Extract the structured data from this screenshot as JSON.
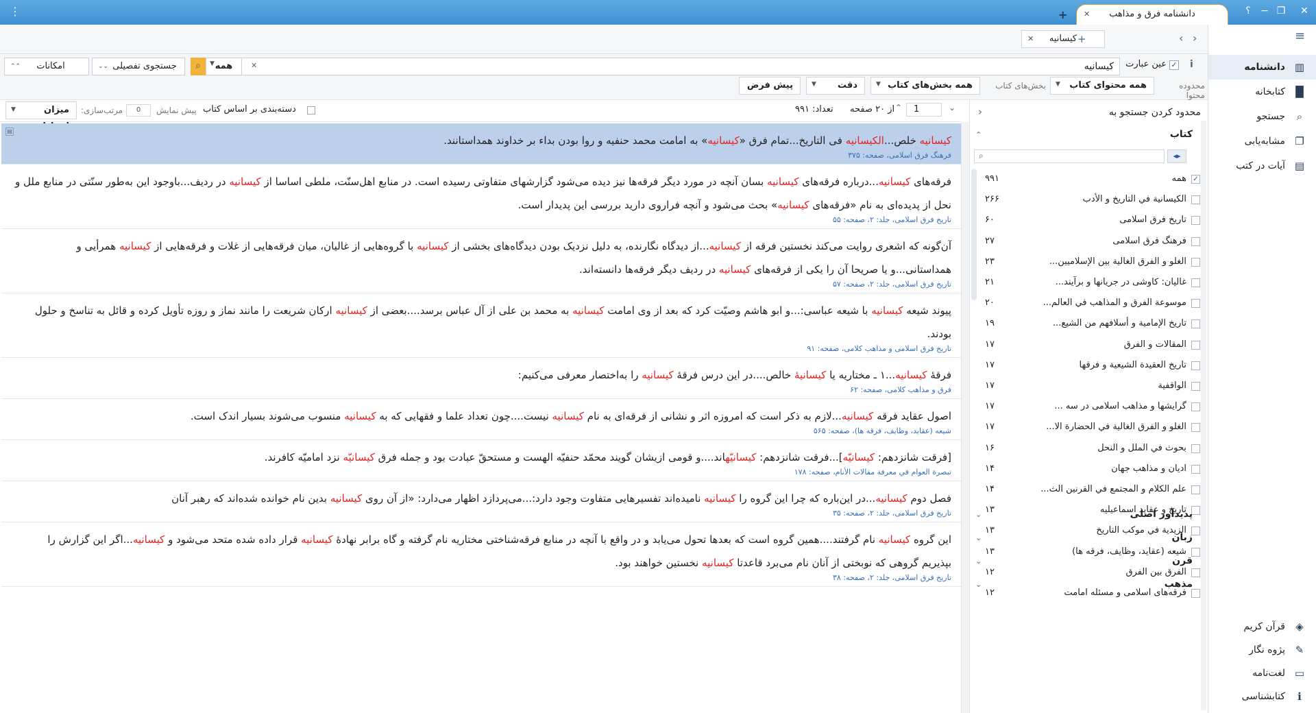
{
  "window": {
    "title": "دانشنامه فرق و مذاهب",
    "help": "؟"
  },
  "doc_tab": {
    "label": "کیسانیه"
  },
  "search": {
    "exact_label": "عین عبارت",
    "query": "کیسانیه",
    "scope_value": "همه",
    "advanced_label": "جستجوی تفصیلی",
    "options_label": "امکانات",
    "info": "i"
  },
  "filters": {
    "range_label": "محدوده محتوا",
    "range_value": "همه محتوای کتاب",
    "parts_label": "بخش‌های کتاب",
    "parts_value": "همه بخش‌های کتاب",
    "precision_value": "دقت",
    "default_value": "پیش فرض"
  },
  "results_bar": {
    "group_label": "دسته‌بندی بر اساس کتاب",
    "preview_label": "پیش نمایش",
    "preview_value": "0",
    "sort_label": "مرتب‌سازی:",
    "sort_value": "میزان ارتباط",
    "page_value": "1",
    "page_total": "از ۲۰ صفحه",
    "count": "تعداد: ۹۹۱"
  },
  "results": [
    {
      "segs": [
        [
          "کیسانیه",
          "k"
        ],
        [
          " خلص...",
          ""
        ],
        [
          "الکیسانیه",
          "k"
        ],
        [
          " فی التاریخ...تمام فرق «",
          ""
        ],
        [
          "کیسانیه",
          "k"
        ],
        [
          "» به امامت محمد حنفیه و روا بودن بداء بر خداوند همداستانند.",
          ""
        ]
      ],
      "source": "فرهنگ فرق اسلامی، صفحه: ۳۷۵"
    },
    {
      "segs": [
        [
          "فرقه‌های ",
          ""
        ],
        [
          "کیسانیه",
          "k"
        ],
        [
          "...درباره فرقه‌های ",
          ""
        ],
        [
          "کیسانیه",
          "k"
        ],
        [
          " بسان آنچه در مورد دیگر فرقه‌ها نیز دیده می‌شود گزارشهای متفاوتی رسیده است. در منابع اهل‌سنّت، ملطی اساسا از ",
          ""
        ],
        [
          "کیسانیه",
          "k"
        ],
        [
          " در ردیف...باوجود این به‌طور سنّتی در منابع ملل و نحل از پدیده‌ای به نام «فرقه‌های ",
          ""
        ],
        [
          "کیسانیه",
          "k"
        ],
        [
          "» بحث می‌شود و آنچه فراروی دارید بررسی این پدیدار است.",
          ""
        ]
      ],
      "source": "تاریخ فرق اسلامی، جلد: ۲، صفحه: ۵۵"
    },
    {
      "segs": [
        [
          "آن‌گونه که اشعری روایت می‌کند نخستین فرقه از ",
          ""
        ],
        [
          "کیسانیه",
          "k"
        ],
        [
          "...از دیدگاه نگارنده، به دلیل نزدیک بودن دیدگاه‌های بخشی از ",
          ""
        ],
        [
          "کیسانیه",
          "k"
        ],
        [
          " با گروه‌هایی از غالیان، میان فرقه‌هایی از غلات و فرقه‌هایی از ",
          ""
        ],
        [
          "کیسانیه",
          "k"
        ],
        [
          " همرأیی و همداستانی...و یا صریحا آن را یکی از فرقه‌های ",
          ""
        ],
        [
          "کیسانیه",
          "k"
        ],
        [
          " در ردیف دیگر فرقه‌ها دانسته‌اند.",
          ""
        ]
      ],
      "source": "تاریخ فرق اسلامی، جلد: ۲، صفحه: ۵۷"
    },
    {
      "segs": [
        [
          "پیوند شیعه ",
          ""
        ],
        [
          "کیسانیه",
          "k"
        ],
        [
          " با شیعه عباسی:...و ابو هاشم وصیّت کرد که بعد از وی امامت ",
          ""
        ],
        [
          "کیسانیه",
          "k"
        ],
        [
          " به محمد بن علی از آل عباس برسد....بعضی از ",
          ""
        ],
        [
          "کیسانیه",
          "k"
        ],
        [
          " ارکان شریعت را مانند نماز و روزه تأویل کرده و قائل به تناسخ و حلول بودند.",
          ""
        ]
      ],
      "source": "تاریخ فرق اسلامی و مذاهب کلامی، صفحه: ۹۱"
    },
    {
      "segs": [
        [
          "فرقۀ ",
          ""
        ],
        [
          "کیسانیه",
          "k"
        ],
        [
          "...۱ ـ مختاریه یا ",
          ""
        ],
        [
          "کیسانیۀ",
          "k"
        ],
        [
          " خالص....در این درس فرقۀ ",
          ""
        ],
        [
          "کیسانیه",
          "k"
        ],
        [
          " را به‌اختصار معرفی می‌کنیم:",
          ""
        ]
      ],
      "source": "فرق و مذاهب کلامی، صفحه: ۶۲"
    },
    {
      "segs": [
        [
          "اصول عقاید فرقه ",
          ""
        ],
        [
          "کیسانیه",
          "k"
        ],
        [
          "...لازم به ذکر است که امروزه اثر و نشانی از فرقه‌ای به نام ",
          ""
        ],
        [
          "کیسانیه",
          "k"
        ],
        [
          " نیست....چون تعداد علما و فقهایی که به ",
          ""
        ],
        [
          "کیسانیه",
          "k"
        ],
        [
          " منسوب می‌شوند بسیار اندک است.",
          ""
        ]
      ],
      "source": "شیعه (عقاید، وظایف، فرقه ها)، صفحه: ۵۶۵"
    },
    {
      "segs": [
        [
          "[فرقت شانزدهم: ",
          ""
        ],
        [
          "کیسانیّه",
          "k"
        ],
        [
          "]...فرقت شانزدهم: ",
          ""
        ],
        [
          "کیسانیّه",
          "k"
        ],
        [
          "اند....و قومی ازیشان گویند محمّد حنفیّه الهست و مستحقّ عبادت بود و جمله فرق ",
          ""
        ],
        [
          "کیسانیّه",
          "k"
        ],
        [
          " نزد امامیّه کافرند.",
          ""
        ]
      ],
      "source": "تبصرة العوام في معرفة مقالات الأنام، صفحه: ۱۷۸"
    },
    {
      "segs": [
        [
          "فصل دوم ",
          ""
        ],
        [
          "کیسانیه",
          "k"
        ],
        [
          "...در این‌باره که چرا این گروه را ",
          ""
        ],
        [
          "کیسانیه",
          "k"
        ],
        [
          " نامیده‌اند تفسیرهایی متفاوت وجود دارد:...می‌پردازد اظهار می‌دارد: «از آن روی ",
          ""
        ],
        [
          "کیسانیه",
          "k"
        ],
        [
          " بدین نام خوانده شده‌اند که رهبر آنان",
          ""
        ]
      ],
      "source": "تاریخ فرق اسلامی، جلد: ۲، صفحه: ۳۵"
    },
    {
      "segs": [
        [
          "این گروه ",
          ""
        ],
        [
          "کیسانیه",
          "k"
        ],
        [
          " نام گرفتند....همین گروه است که بعدها تحول می‌یابد و در واقع با آنچه در منابع فرقه‌شناختی مختاریه نام گرفته و گاه برابر نهادۀ ",
          ""
        ],
        [
          "کیسانیه",
          "k"
        ],
        [
          " قرار داده شده متحد می‌شود و ",
          ""
        ],
        [
          "کیسانیه",
          "k"
        ],
        [
          "...اگر این گزارش را بپذیریم گروهی که نوبختی از آنان نام می‌برد قاعدتا ",
          ""
        ],
        [
          "کیسانیه",
          "k"
        ],
        [
          " نخستین خواهند بود.",
          ""
        ]
      ],
      "source": "تاریخ فرق اسلامی، جلد: ۲، صفحه: ۳۸"
    }
  ],
  "panel": {
    "title": "محدود کردن جستجو به",
    "books_heading": "کتاب",
    "books": [
      {
        "name": "همه",
        "count": "۹۹۱",
        "checked": "✓"
      },
      {
        "name": "الكيسانية في التاريخ و الأدب",
        "count": "۲۶۶",
        "checked": ""
      },
      {
        "name": "تاریخ فرق اسلامی",
        "count": "۶۰",
        "checked": ""
      },
      {
        "name": "فرهنگ فرق اسلامی",
        "count": "۲۷",
        "checked": ""
      },
      {
        "name": "الغلو و الفرق الغالية بين الإسلاميين...",
        "count": "۲۳",
        "checked": ""
      },
      {
        "name": "غالیان: کاوشی در جریانها و برآیند...",
        "count": "۲۱",
        "checked": ""
      },
      {
        "name": "موسوعة الفرق و المذاهب في العالم...",
        "count": "۲۰",
        "checked": ""
      },
      {
        "name": "تاريخ الإمامية و أسلافهم من الشيع...",
        "count": "۱۹",
        "checked": ""
      },
      {
        "name": "المقالات و الفرق",
        "count": "۱۷",
        "checked": ""
      },
      {
        "name": "تاريخ العقيدة الشيعية و فرقها",
        "count": "۱۷",
        "checked": ""
      },
      {
        "name": "الواقفية",
        "count": "۱۷",
        "checked": ""
      },
      {
        "name": "گرایشها و مذاهب اسلامی در سه ...",
        "count": "۱۷",
        "checked": ""
      },
      {
        "name": "الغلو و الفرق الغالية في الحضارة الا...",
        "count": "۱۷",
        "checked": ""
      },
      {
        "name": "بحوث في الملل و النحل",
        "count": "۱۶",
        "checked": ""
      },
      {
        "name": "ادیان و مذاهب جهان",
        "count": "۱۴",
        "checked": ""
      },
      {
        "name": "علم الكلام و المجتمع في القرنين الث...",
        "count": "۱۴",
        "checked": ""
      },
      {
        "name": "تاریخ و عقاید اسماعیلیه",
        "count": "۱۳",
        "checked": ""
      },
      {
        "name": "الزيدية في موكب التاريخ",
        "count": "۱۳",
        "checked": ""
      },
      {
        "name": "شیعه (عقاید، وظایف، فرقه ها)",
        "count": "۱۳",
        "checked": ""
      },
      {
        "name": "الفرق بين الفرق",
        "count": "۱۲",
        "checked": ""
      },
      {
        "name": "فرقه‌های اسلامی و مسئله امامت",
        "count": "۱۲",
        "checked": ""
      }
    ],
    "sections": [
      "پدیدآور اصلی",
      "زبان",
      "قرن",
      "مذهب"
    ]
  },
  "nav": {
    "top": [
      {
        "label": "دانشنامه",
        "icon": "encyclopedia-icon",
        "glyph": "▥"
      },
      {
        "label": "کتابخانه",
        "icon": "library-icon",
        "glyph": "▐▌"
      },
      {
        "label": "جستجو",
        "icon": "search-icon",
        "glyph": "⌕"
      },
      {
        "label": "مشابه‌یابی",
        "icon": "similar-icon",
        "glyph": "❐"
      },
      {
        "label": "آیات در کتب",
        "icon": "verses-icon",
        "glyph": "▤"
      }
    ],
    "bottom": [
      {
        "label": "قرآن کریم",
        "icon": "quran-icon",
        "glyph": "◈"
      },
      {
        "label": "پژوه نگار",
        "icon": "notes-icon",
        "glyph": "✎"
      },
      {
        "label": "لغت‌نامه",
        "icon": "dictionary-icon",
        "glyph": "▭"
      },
      {
        "label": "کتابشناسی",
        "icon": "bibliography-icon",
        "glyph": "ℹ"
      }
    ]
  },
  "colors": {
    "accent": "#3f8fd2",
    "keyword": "#e02424",
    "source": "#3a6fb4",
    "selected": "#bcd0ec",
    "search_button": "#f0b43c"
  }
}
